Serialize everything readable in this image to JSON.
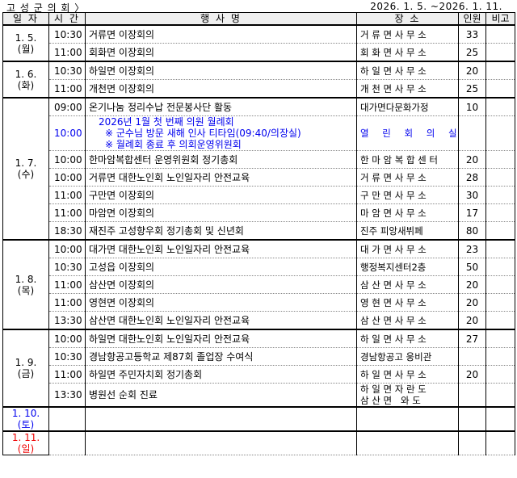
{
  "header": {
    "org": "고 성 군 의 회 〉",
    "period": "2026. 1. 5. ~2026. 1. 11."
  },
  "columns": [
    "일 자",
    "시 간",
    "행 사 명",
    "장 소",
    "인원",
    "비고"
  ],
  "days": [
    {
      "date": "1. 5.",
      "dow": "(월)",
      "rows": [
        {
          "time": "10:30",
          "event": "거류면 이장회의",
          "place": "거 류 면 사 무 소",
          "count": "33"
        },
        {
          "time": "11:00",
          "event": "회화면 이장회의",
          "place": "회 화 면 사 무 소",
          "count": "25"
        }
      ]
    },
    {
      "date": "1. 6.",
      "dow": "(화)",
      "rows": [
        {
          "time": "10:30",
          "event": "하일면 이장회의",
          "place": "하 일 면 사 무 소",
          "count": "20"
        },
        {
          "time": "11:00",
          "event": "개천면 이장회의",
          "place": "개 천 면 사 무 소",
          "count": "25"
        }
      ]
    },
    {
      "date": "1. 7.",
      "dow": "(수)",
      "rows": [
        {
          "time": "09:00",
          "event": "온기나눔 정리수납 전문봉사단 활동",
          "place": "대가면다문화가정",
          "count": "10"
        },
        {
          "time": "10:00",
          "event_lines": [
            "2026년 1월 첫 번째 의원 월례회",
            "※ 군수님 방문 새해 인사 티타임(09:40/의장실)",
            "※ 월례회 종료 후 의회운영위원회"
          ],
          "place": "열 린 회 의 실",
          "count": "",
          "highlight": "blue"
        },
        {
          "time": "10:00",
          "event": "한마암복합센터 운영위원회 정기총회",
          "place": "한 마 암 복 합 센 터",
          "count": "20"
        },
        {
          "time": "10:00",
          "event": "거류면 대한노인회 노인일자리 안전교육",
          "place": "거 류 면 사 무 소",
          "count": "28"
        },
        {
          "time": "11:00",
          "event": "구만면 이장회의",
          "place": "구 만 면 사 무 소",
          "count": "30"
        },
        {
          "time": "11:00",
          "event": "마암면 이장회의",
          "place": "마 암 면 사 무 소",
          "count": "17"
        },
        {
          "time": "18:30",
          "event": "재진주 고성향우회 정기총회 및 신년회",
          "place": "진주 피앙새뷔페",
          "count": "80"
        }
      ]
    },
    {
      "date": "1. 8.",
      "dow": "(목)",
      "rows": [
        {
          "time": "10:00",
          "event": "대가면 대한노인회 노인일자리 안전교육",
          "place": "대 가 면 사 무 소",
          "count": "23"
        },
        {
          "time": "10:30",
          "event": "고성읍 이장회의",
          "place": "행정복지센터2층",
          "count": "50"
        },
        {
          "time": "11:00",
          "event": "삼산면 이장회의",
          "place": "삼 산 면 사 무 소",
          "count": "20"
        },
        {
          "time": "11:00",
          "event": "영현면 이장회의",
          "place": "영 현 면 사 무 소",
          "count": "20"
        },
        {
          "time": "13:30",
          "event": "삼산면 대한노인회 노인일자리 안전교육",
          "place": "삼 산 면 사 무 소",
          "count": "20"
        }
      ]
    },
    {
      "date": "1. 9.",
      "dow": "(금)",
      "rows": [
        {
          "time": "10:00",
          "event": "하일면 대한노인회 노인일자리 안전교육",
          "place": "하 일 면 사 무 소",
          "count": "27"
        },
        {
          "time": "10:30",
          "event": "경남항공고등학교 제87회 졸업장 수여식",
          "place": "경남항공고 웅비관",
          "count": ""
        },
        {
          "time": "11:00",
          "event": "하일면 주민자치회 정기총회",
          "place": "하 일 면 사 무 소",
          "count": "20"
        },
        {
          "time": "13:30",
          "event": "병원선 순회 진료",
          "place_lines": [
            "하 일 면 자 란 도",
            "삼 산 면   와 도"
          ],
          "count": ""
        }
      ]
    },
    {
      "date": "1. 10.",
      "dow": "(토)",
      "color": "blue",
      "rows": []
    },
    {
      "date": "1. 11.",
      "dow": "(일)",
      "color": "red",
      "rows": []
    }
  ]
}
